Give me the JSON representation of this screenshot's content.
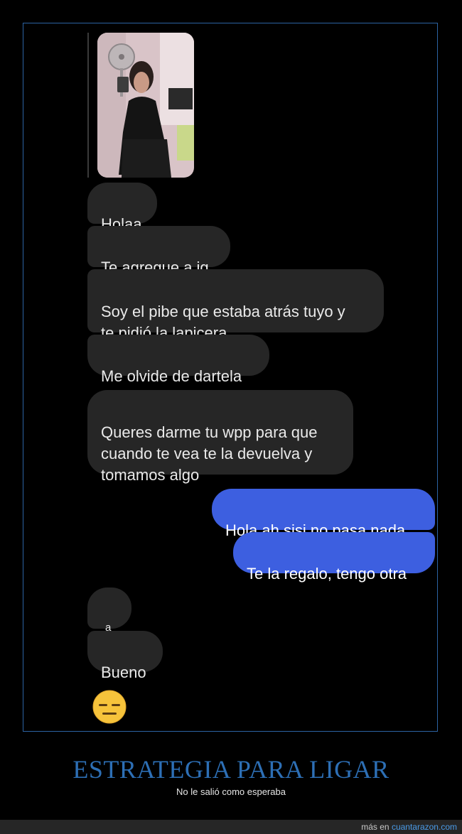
{
  "chat": {
    "messages": [
      {
        "from": "them",
        "text": "Holaa"
      },
      {
        "from": "them",
        "text": "Te agregue a ig"
      },
      {
        "from": "them",
        "text": "Soy el pibe que estaba atrás tuyo y\nte pidió la lapicera"
      },
      {
        "from": "them",
        "text": "Me olvide de dartela"
      },
      {
        "from": "them",
        "text": "Queres darme tu wpp para que\ncuando te vea te la devuelva y\ntomamos algo"
      },
      {
        "from": "me",
        "text": "Hola ah sisi no pasa nada"
      },
      {
        "from": "me",
        "text": "Te la regalo, tengo otra"
      },
      {
        "from": "them",
        "text": "a"
      },
      {
        "from": "them",
        "text": "Bueno"
      }
    ],
    "reaction_emoji": "expressionless-face-emoji",
    "colors": {
      "received_bubble": "#262626",
      "sent_bubble": "#3d5fe0",
      "background": "#000000"
    }
  },
  "caption": {
    "title": "ESTRATEGIA PARA LIGAR",
    "subtitle": "No le salió como esperaba",
    "title_color": "#2d6fb5"
  },
  "footer": {
    "prefix": "más en",
    "site": "cuantarazon.com"
  }
}
